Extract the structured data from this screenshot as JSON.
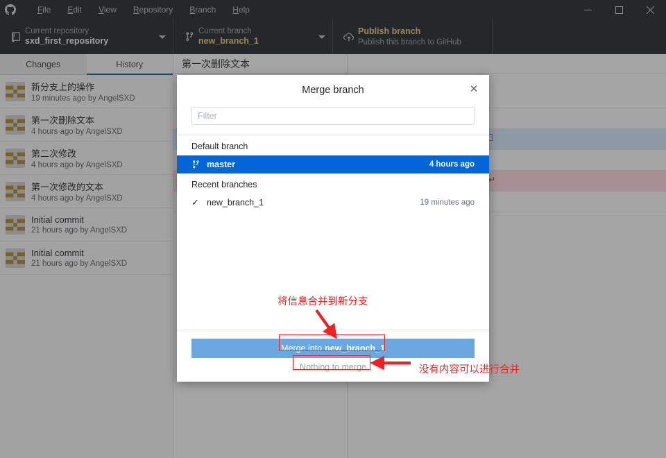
{
  "window": {
    "app_icon": "github-logo-icon",
    "menu": [
      {
        "label": "File",
        "accel": "F"
      },
      {
        "label": "Edit",
        "accel": "E"
      },
      {
        "label": "View",
        "accel": "V"
      },
      {
        "label": "Repository",
        "accel": "R"
      },
      {
        "label": "Branch",
        "accel": "B"
      },
      {
        "label": "Help",
        "accel": "H"
      }
    ],
    "controls": {
      "minimize": "minimize-icon",
      "maximize": "maximize-icon",
      "close": "close-icon"
    }
  },
  "toolbar": {
    "repository": {
      "icon": "repository-icon",
      "label": "Current repository",
      "value": "sxd_first_repository",
      "caret": "chevron-down-icon"
    },
    "branch": {
      "icon": "branch-icon",
      "label": "Current branch",
      "value": "new_branch_1",
      "caret": "chevron-down-icon"
    },
    "publish": {
      "icon": "cloud-upload-icon",
      "title": "Publish branch",
      "subtitle": "Publish this branch to GitHub"
    }
  },
  "sidebar": {
    "tabs": [
      {
        "label": "Changes",
        "active": false
      },
      {
        "label": "History",
        "active": true
      }
    ],
    "commits": [
      {
        "title": "新分支上的操作",
        "meta": "19 minutes ago by AngelSXD"
      },
      {
        "title": "第一次删除文本",
        "meta": "4 hours ago by AngelSXD"
      },
      {
        "title": "第二次修改",
        "meta": "4 hours ago by AngelSXD"
      },
      {
        "title": "第一次修改的文本",
        "meta": "4 hours ago by AngelSXD"
      },
      {
        "title": "Initial commit",
        "meta": "21 hours ago by AngelSXD"
      },
      {
        "title": "Initial commit",
        "meta": "21 hours ago by AngelSXD"
      }
    ]
  },
  "detail": {
    "commit_title": "第一次删除文本"
  },
  "dialog": {
    "title": "Merge branch",
    "close_icon": "close-icon",
    "filter": {
      "value": "",
      "placeholder": "Filter"
    },
    "sections": [
      {
        "heading": "Default branch",
        "branches": [
          {
            "name": "master",
            "time": "4 hours ago",
            "icon": "branch-icon",
            "selected": true,
            "current": false
          }
        ]
      },
      {
        "heading": "Recent branches",
        "branches": [
          {
            "name": "new_branch_1",
            "time": "19 minutes ago",
            "icon": "check-icon",
            "selected": false,
            "current": true
          }
        ]
      }
    ],
    "merge_button": {
      "prefix": "Merge into ",
      "branch": "new_branch_1"
    },
    "status_text": "Nothing to merge"
  },
  "annotations": [
    {
      "id": "merge-target-note",
      "text": "将信息合并到新分支",
      "color": "#ee2222"
    },
    {
      "id": "nothing-to-merge-note",
      "text": "没有内容可以进行合并",
      "color": "#ee2222"
    }
  ],
  "colors": {
    "accent_blue": "#0366d6",
    "titlebar": "#24292e",
    "merge_button": "#6ba7e0",
    "annotation_red": "#ee2222",
    "tab_underline": "#1059a8"
  }
}
